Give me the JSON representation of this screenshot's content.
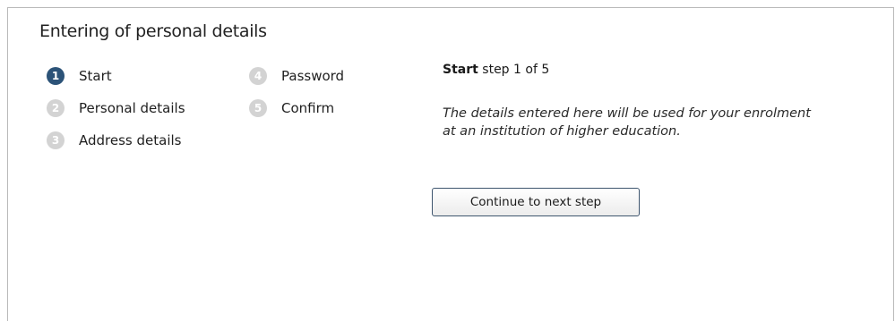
{
  "page_title": "Entering of personal details",
  "steps": [
    {
      "number": "1",
      "label": "Start",
      "active": true
    },
    {
      "number": "2",
      "label": "Personal details",
      "active": false
    },
    {
      "number": "3",
      "label": "Address details",
      "active": false
    },
    {
      "number": "4",
      "label": "Password",
      "active": false
    },
    {
      "number": "5",
      "label": "Confirm",
      "active": false
    }
  ],
  "step_indicator": {
    "current_step_name": "Start",
    "progress_text": "step 1 of 5"
  },
  "description": "The details entered here will be used for your enrolment at an institution of higher education.",
  "continue_button_label": "Continue to next step",
  "colors": {
    "active_step": "#2c5378",
    "inactive_step": "#d3d3d3"
  }
}
